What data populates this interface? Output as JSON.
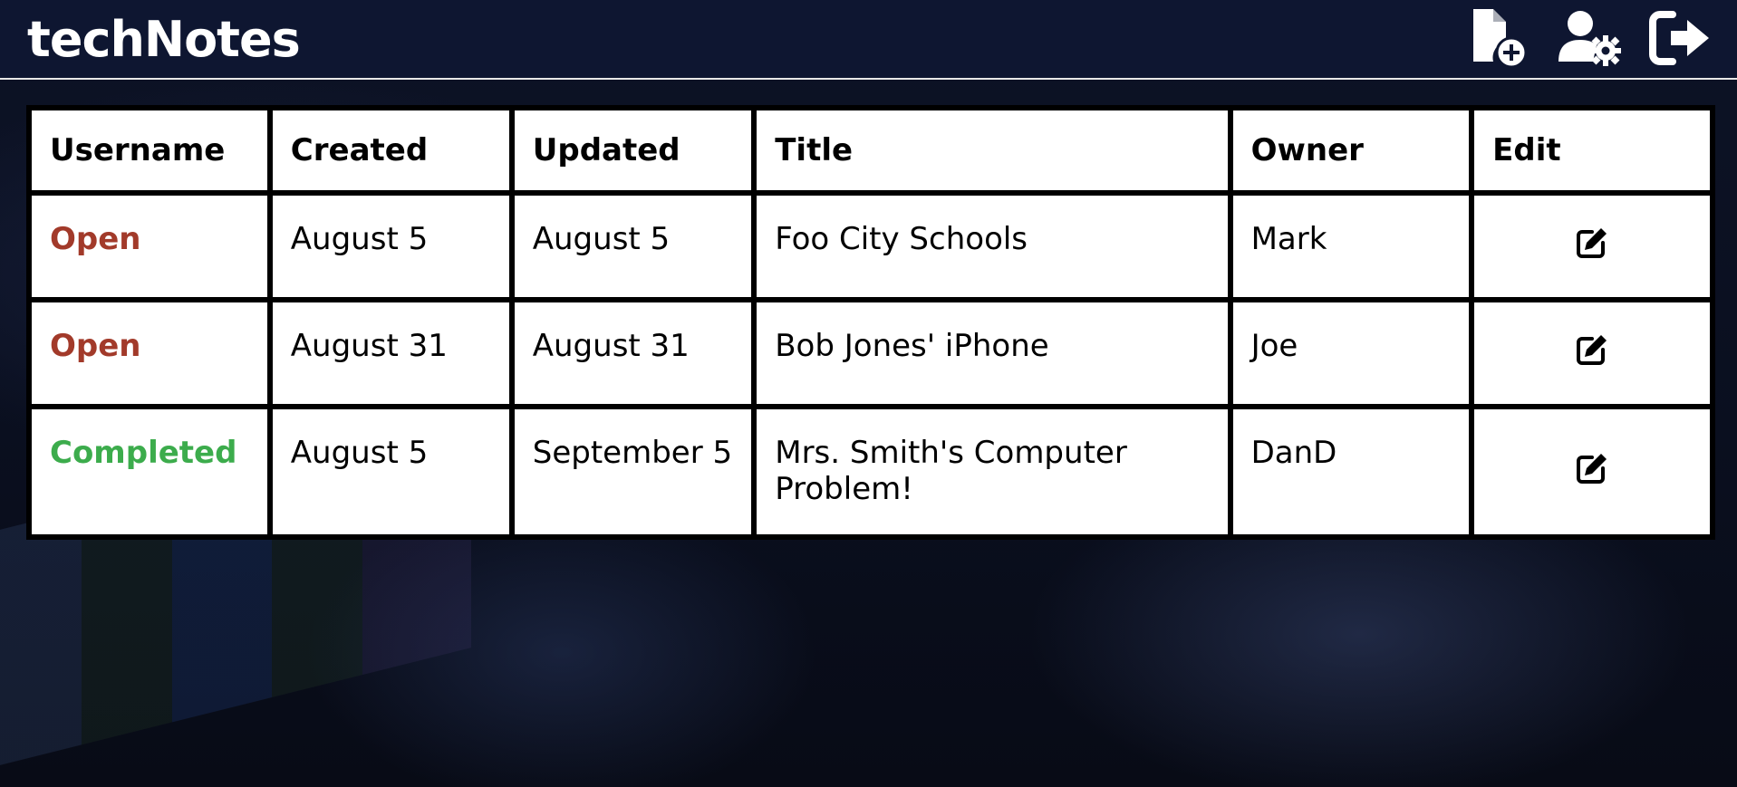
{
  "header": {
    "title": "techNotes",
    "actions": [
      {
        "icon": "new-note-icon",
        "name": "new-note-button"
      },
      {
        "icon": "user-settings-icon",
        "name": "user-settings-button"
      },
      {
        "icon": "logout-icon",
        "name": "logout-button"
      }
    ]
  },
  "table": {
    "columns": [
      "Username",
      "Created",
      "Updated",
      "Title",
      "Owner",
      "Edit"
    ],
    "rows": [
      {
        "status": "Open",
        "created": "August 5",
        "updated": "August 5",
        "title": "Foo City Schools",
        "owner": "Mark",
        "edit_icon": "edit-icon"
      },
      {
        "status": "Open",
        "created": "August 31",
        "updated": "August 31",
        "title": "Bob Jones' iPhone",
        "owner": "Joe",
        "edit_icon": "edit-icon"
      },
      {
        "status": "Completed",
        "created": "August 5",
        "updated": "September 5",
        "title": "Mrs. Smith's Computer Problem!",
        "owner": "DanD",
        "edit_icon": "edit-icon"
      }
    ]
  },
  "colors": {
    "header_bg": "#0e1631",
    "status_open": "#a23a2a",
    "status_completed": "#3cac4c"
  }
}
